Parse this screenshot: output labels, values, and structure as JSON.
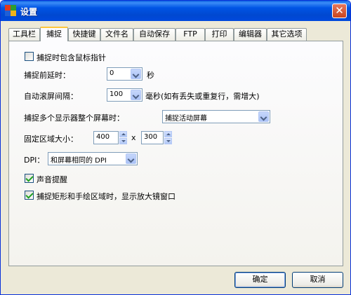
{
  "window": {
    "title": "设置",
    "close_glyph": "✕"
  },
  "tabs": [
    {
      "label": "工具栏"
    },
    {
      "label": "捕捉",
      "active": true
    },
    {
      "label": "快捷键"
    },
    {
      "label": "文件名"
    },
    {
      "label": "自动保存"
    },
    {
      "label": "FTP"
    },
    {
      "label": "打印"
    },
    {
      "label": "编辑器"
    },
    {
      "label": "其它选项"
    }
  ],
  "capture": {
    "include_cursor": {
      "label": "捕捉时包含鼠标指针",
      "checked": false
    },
    "delay": {
      "label": "捕捉前延时：",
      "value": "0",
      "unit": "秒"
    },
    "scroll_interval": {
      "label": "自动滚屏间隔：",
      "value": "100",
      "unit": "毫秒(如有丢失或重复行，需增大)"
    },
    "multi_monitor": {
      "label": "捕捉多个显示器整个屏幕时：",
      "value": "捕捉活动屏幕"
    },
    "fixed_region": {
      "label": "固定区域大小：",
      "width": "400",
      "separator": "x",
      "height": "300"
    },
    "dpi": {
      "label": "DPI：",
      "value": "和屏幕相同的 DPI"
    },
    "sound_alert": {
      "label": "声音提醒",
      "checked": true
    },
    "show_magnifier": {
      "label": "捕捉矩形和手绘区域时，显示放大镜窗口",
      "checked": true
    }
  },
  "buttons": {
    "ok": "确定",
    "cancel": "取消"
  },
  "colors": {
    "titlebar": "#0055e5",
    "tab_highlight": "#ffc73c",
    "window_bg": "#ece9d8",
    "checkmark": "#21a121"
  }
}
